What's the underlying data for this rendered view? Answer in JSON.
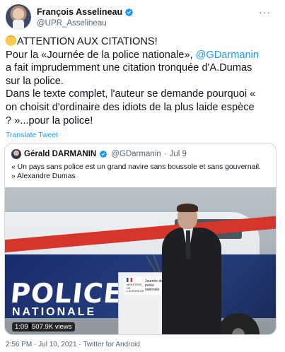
{
  "tweet": {
    "display_name": "François Asselineau",
    "handle": "@UPR_Asselineau",
    "more_icon": "more-horizontal-icon",
    "lines": [
      {
        "emoji": true,
        "text": "ATTENTION AUX CITATIONS!"
      },
      {
        "pre": "Pour la «Journée de la police nationale», ",
        "mention": "@GDarmanin"
      },
      {
        "text": "a fait imprudemment une citation tronquée d'A.Dumas"
      },
      {
        "text": "sur la police."
      },
      {
        "text": "Dans le texte complet, l'auteur se demande pourquoi «"
      },
      {
        "text": "on choisit d'ordinaire des idiots de la plus laide espèce"
      },
      {
        "text": "? »...pour la police!"
      }
    ],
    "translate_label": "Translate Tweet",
    "timestamp": "2:56 PM · Jul 10, 2021 · Twitter for Android"
  },
  "quote": {
    "display_name": "Gérald DARMANIN",
    "handle": "@GDarmanin",
    "separator": "·",
    "date": "Jul 9",
    "text": "« Un pays sans police est un grand navire sans boussole et sans gouvernail. » Alexandre Dumas",
    "video": {
      "van_word1": "POLICE",
      "van_word2": "NATIONALE",
      "lectern_label": "Journée de la police nationale",
      "lectern_logo_text": "MINISTÈRE DE L'INTÉRIEUR",
      "duration": "1:09",
      "views": "507.9K views"
    }
  },
  "colors": {
    "accent": "#1d9bf0",
    "text": "#0f1419",
    "secondary": "#536471",
    "border": "#cfd9de"
  }
}
